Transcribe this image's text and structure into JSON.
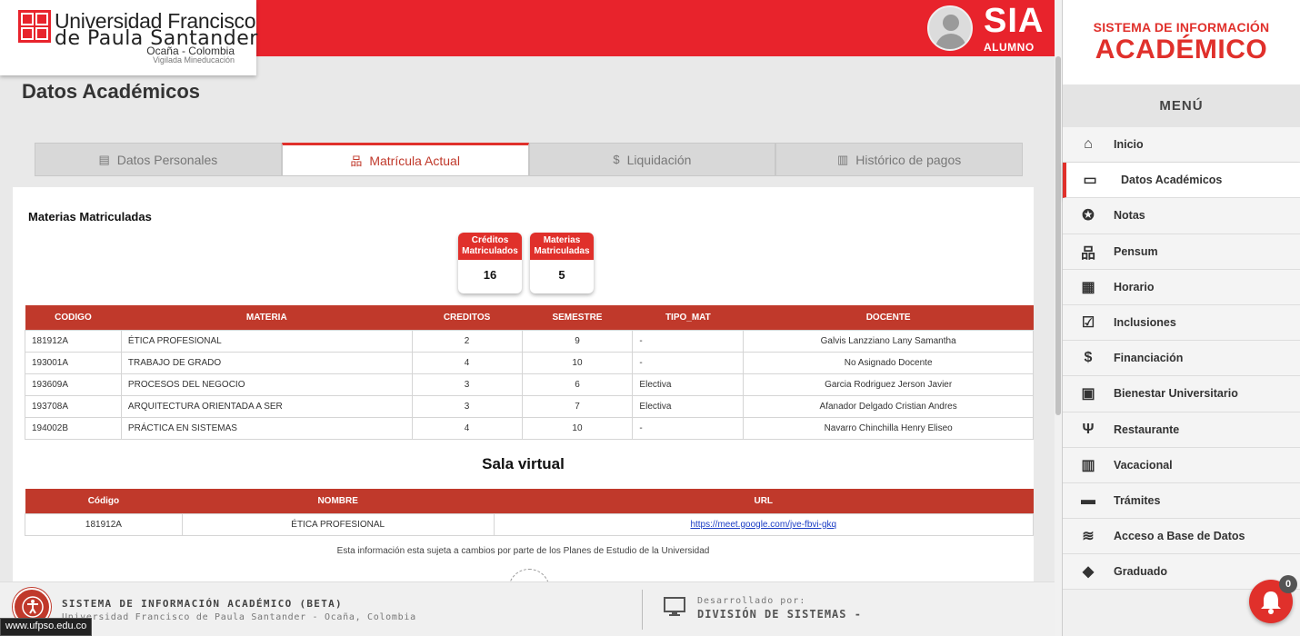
{
  "header": {
    "univ_line1": "Universidad Francisco",
    "univ_line2": "de Paula Santander",
    "univ_line3": "Ocaña - Colombia",
    "univ_line4": "Vigilada Mineducación",
    "sia_title": "SIA",
    "sia_subtitle": "ALUMNO"
  },
  "page": {
    "title": "Datos Académicos"
  },
  "tabs": [
    {
      "label": "Datos Personales",
      "icon": "id-card-icon"
    },
    {
      "label": "Matrícula Actual",
      "icon": "sitemap-icon",
      "active": true
    },
    {
      "label": "Liquidación",
      "icon": "dollar-circle-icon"
    },
    {
      "label": "Histórico de pagos",
      "icon": "chart-icon"
    }
  ],
  "matricula": {
    "section_title": "Materias Matriculadas",
    "cards": [
      {
        "label_line1": "Créditos",
        "label_line2": "Matriculados",
        "value": "16"
      },
      {
        "label_line1": "Materias",
        "label_line2": "Matriculadas",
        "value": "5"
      }
    ],
    "columns": [
      "CODIGO",
      "MATERIA",
      "CREDITOS",
      "SEMESTRE",
      "TIPO_MAT",
      "DOCENTE"
    ],
    "rows": [
      [
        "181912A",
        "ÉTICA PROFESIONAL",
        "2",
        "9",
        "-",
        "Galvis Lanzziano Lany Samantha"
      ],
      [
        "193001A",
        "TRABAJO DE GRADO",
        "4",
        "10",
        "-",
        "No Asignado Docente"
      ],
      [
        "193609A",
        "PROCESOS DEL NEGOCIO",
        "3",
        "6",
        "Electiva",
        "Garcia Rodriguez Jerson Javier"
      ],
      [
        "193708A",
        "ARQUITECTURA ORIENTADA A SER",
        "3",
        "7",
        "Electiva",
        "Afanador Delgado Cristian Andres"
      ],
      [
        "194002B",
        "PRÁCTICA EN SISTEMAS",
        "4",
        "10",
        "-",
        "Navarro Chinchilla Henry Eliseo"
      ]
    ]
  },
  "sala": {
    "title": "Sala virtual",
    "columns": [
      "Código",
      "NOMBRE",
      "URL"
    ],
    "rows": [
      [
        "181912A",
        "ÉTICA PROFESIONAL",
        "https://meet.google.com/jve-fbvi-gkq"
      ]
    ],
    "note": "Esta información esta sujeta a cambios por parte de los Planes de Estudio de la Universidad"
  },
  "footer": {
    "system_name": "SISTEMA DE INFORMACIÓN ACADÉMICO (BETA)",
    "university": "Universidad Francisco de Paula Santander - Ocaña, Colombia",
    "dev_label": "Desarrollado por:",
    "dev_name": "DIVISIÓN DE SISTEMAS -",
    "url_tooltip": "www.ufpso.edu.co"
  },
  "sidebar": {
    "title_line1": "SISTEMA DE INFORMACIÓN",
    "title_line2": "ACADÉMICO",
    "menu_title": "MENÚ",
    "items": [
      {
        "label": "Inicio",
        "icon": "home-icon"
      },
      {
        "label": "Datos Académicos",
        "icon": "card-icon",
        "active": true
      },
      {
        "label": "Notas",
        "icon": "medal-icon"
      },
      {
        "label": "Pensum",
        "icon": "sitemap-icon"
      },
      {
        "label": "Horario",
        "icon": "calendar-icon"
      },
      {
        "label": "Inclusiones",
        "icon": "checkbox-icon"
      },
      {
        "label": "Financiación",
        "icon": "dollar-circle-icon"
      },
      {
        "label": "Bienestar Universitario",
        "icon": "briefcase-icon"
      },
      {
        "label": "Restaurante",
        "icon": "utensils-icon"
      },
      {
        "label": "Vacacional",
        "icon": "books-icon"
      },
      {
        "label": "Trámites",
        "icon": "folder-icon"
      },
      {
        "label": "Acceso a Base de Datos",
        "icon": "database-icon"
      },
      {
        "label": "Graduado",
        "icon": "graduation-cap-icon"
      }
    ]
  },
  "notifications": {
    "count": "0"
  },
  "colors": {
    "brand_red": "#e0302b",
    "table_header": "#c0392b"
  }
}
